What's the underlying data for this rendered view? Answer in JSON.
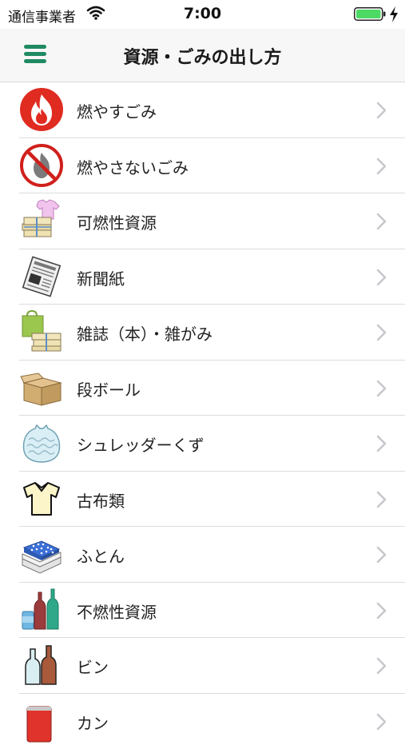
{
  "status_bar": {
    "carrier": "通信事業者",
    "time": "7:00",
    "wifi_icon": "wifi-icon",
    "battery_icon": "battery-icon",
    "charge_icon": "charging-bolt-icon"
  },
  "header": {
    "title": "資源・ごみの出し方",
    "menu_icon": "hamburger-menu-icon",
    "accent_color": "#1f8a62"
  },
  "list": {
    "items": [
      {
        "label": "燃やすごみ",
        "icon": "fire-icon"
      },
      {
        "label": "燃やさないごみ",
        "icon": "no-fire-icon"
      },
      {
        "label": "可燃性資源",
        "icon": "clothes-papers-icon"
      },
      {
        "label": "新聞紙",
        "icon": "newspaper-icon"
      },
      {
        "label": "雑誌（本）・雑がみ",
        "icon": "magazine-paper-bag-icon"
      },
      {
        "label": "段ボール",
        "icon": "cardboard-box-icon"
      },
      {
        "label": "シュレッダーくず",
        "icon": "shredder-bag-icon"
      },
      {
        "label": "古布類",
        "icon": "shirt-icon"
      },
      {
        "label": "ふとん",
        "icon": "futon-icon"
      },
      {
        "label": "不燃性資源",
        "icon": "bottles-can-icon"
      },
      {
        "label": "ビン",
        "icon": "glass-bottles-icon"
      },
      {
        "label": "カン",
        "icon": "can-icon"
      }
    ],
    "chevron_icon": "chevron-right-icon"
  }
}
